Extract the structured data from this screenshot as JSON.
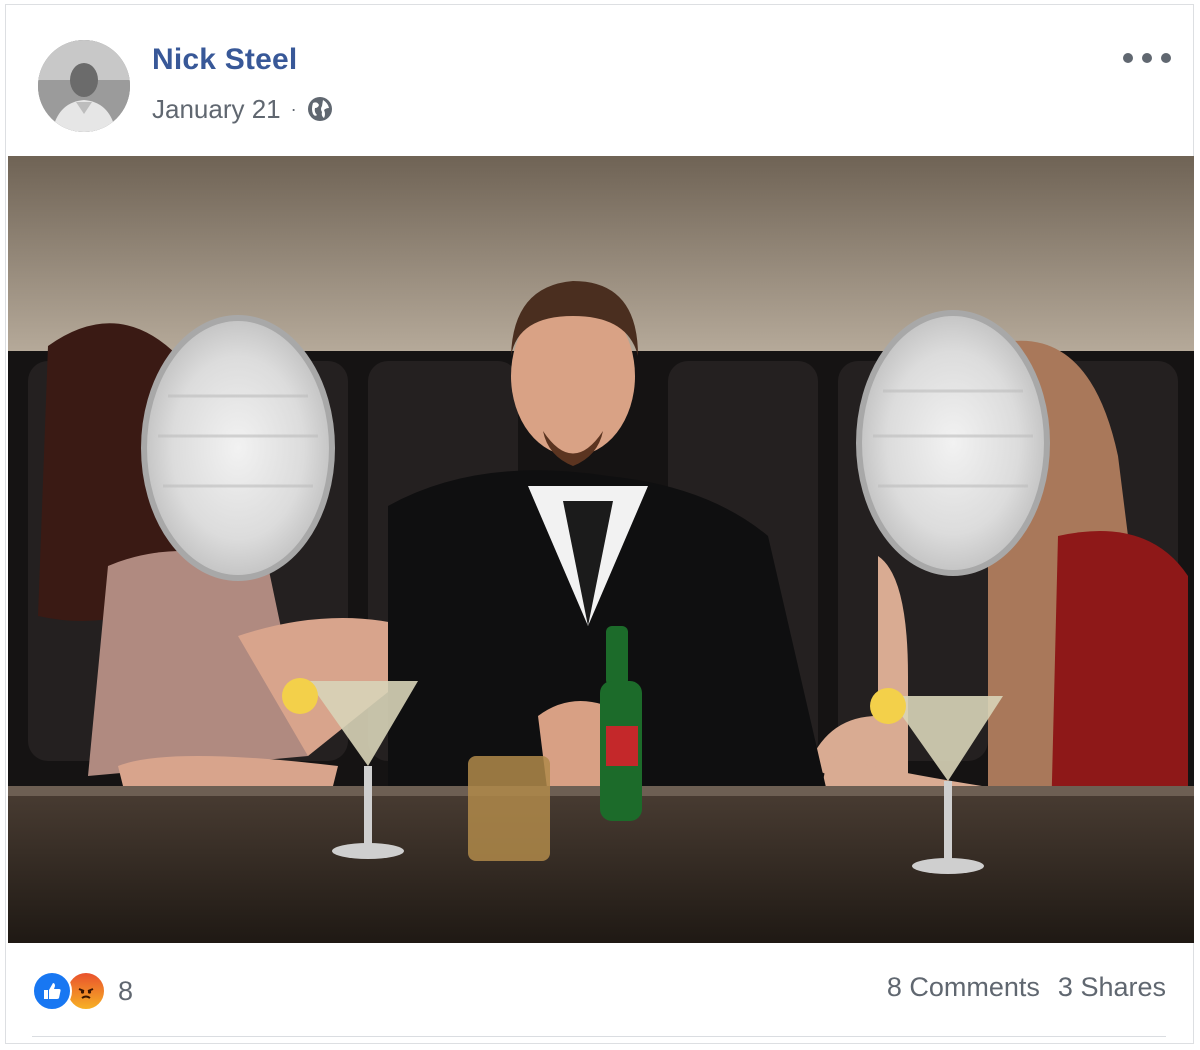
{
  "post": {
    "author": "Nick Steel",
    "date": "January 21",
    "separator": "·",
    "privacy_icon": "globe-icon",
    "menu_icon": "more-options-icon"
  },
  "reactions": {
    "icons": [
      "like-icon",
      "angry-icon"
    ],
    "count": "8"
  },
  "engagement": {
    "comments": "8 Comments",
    "shares": "3 Shares"
  },
  "colors": {
    "author_link": "#385898",
    "secondary_text": "#606770",
    "like_blue": "#1877f2"
  }
}
